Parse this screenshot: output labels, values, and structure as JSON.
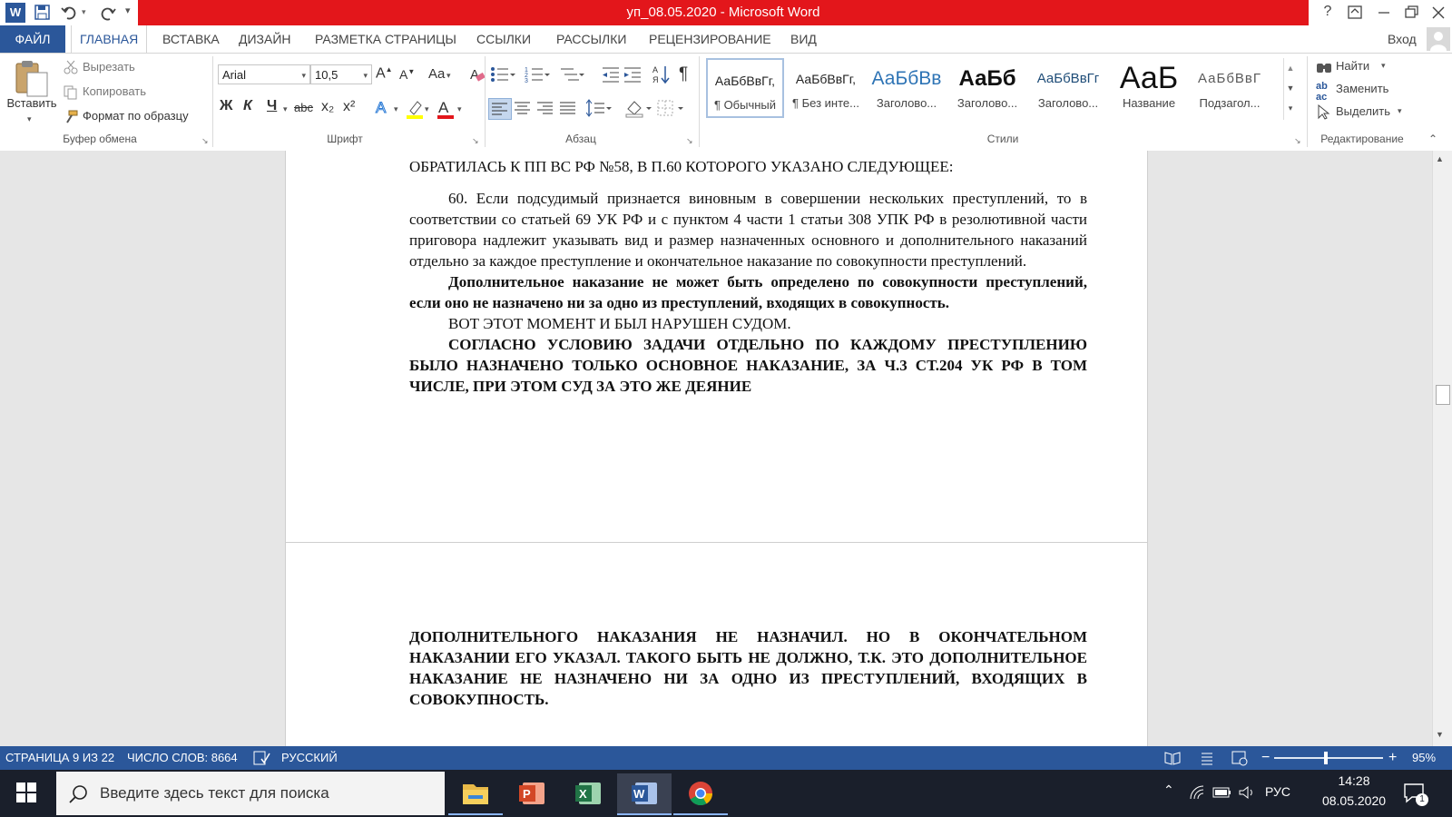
{
  "window": {
    "title": "уп_08.05.2020 -  Microsoft Word",
    "help": "?",
    "sign_in": "Вход"
  },
  "tabs": [
    "ФАЙЛ",
    "ГЛАВНАЯ",
    "ВСТАВКА",
    "ДИЗАЙН",
    "РАЗМЕТКА СТРАНИЦЫ",
    "ССЫЛКИ",
    "РАССЫЛКИ",
    "РЕЦЕНЗИРОВАНИЕ",
    "ВИД"
  ],
  "ribbon": {
    "clipboard": {
      "paste": "Вставить",
      "cut": "Вырезать",
      "copy": "Копировать",
      "format_painter": "Формат по образцу",
      "label": "Буфер обмена"
    },
    "font": {
      "name": "Arial",
      "size": "10,5",
      "change_case": "Aa",
      "bold": "Ж",
      "italic": "К",
      "underline": "Ч",
      "strike": "abc",
      "sub": "x₂",
      "sup": "x²",
      "label": "Шрифт"
    },
    "paragraph": {
      "label": "Абзац"
    },
    "styles": {
      "label": "Стили",
      "items": [
        {
          "preview": "АаБбВвГг,",
          "name": "¶ Обычный"
        },
        {
          "preview": "АаБбВвГг,",
          "name": "¶ Без инте..."
        },
        {
          "preview": "АаБбВв",
          "name": "Заголово..."
        },
        {
          "preview": "АаБб",
          "name": "Заголово..."
        },
        {
          "preview": "АаБбВвГг",
          "name": "Заголово..."
        },
        {
          "preview": "АаБ",
          "name": "Название"
        },
        {
          "preview": "АаБбВвГ",
          "name": "Подзагол..."
        }
      ]
    },
    "editing": {
      "label": "Редактирование",
      "find": "Найти",
      "replace": "Заменить",
      "select": "Выделить"
    }
  },
  "document": {
    "page1": {
      "heading_line": "ОБРАТИЛАСЬ К ПП ВС РФ №58, В П.60 КОТОРОГО УКАЗАНО СЛЕДУЮЩЕЕ:",
      "para1": "60. Если подсудимый признается виновным в совершении нескольких преступлений, то в соответствии со статьей 69 УК РФ и с пунктом 4 части 1 статьи 308 УПК РФ в резолютивной части приговора надлежит указывать вид и размер назначенных основного и дополнительного наказаний отдельно за каждое преступление и окончательное наказание по совокупности преступлений.",
      "para2": "Дополнительное наказание не может быть определено по совокупности преступлений, если оно не назначено ни за одно из преступлений, входящих в совокупность.",
      "para3": "ВОТ ЭТОТ МОМЕНТ И БЫЛ НАРУШЕН СУДОМ.",
      "para4": "СОГЛАСНО УСЛОВИЮ ЗАДАЧИ ОТДЕЛЬНО ПО КАЖДОМУ ПРЕСТУПЛЕНИЮ БЫЛО НАЗНАЧЕНО ТОЛЬКО ОСНОВНОЕ НАКАЗАНИЕ, ЗА Ч.3 СТ.204 УК РФ В ТОМ ЧИСЛЕ, ПРИ ЭТОМ СУД ЗА ЭТО ЖЕ ДЕЯНИЕ"
    },
    "page2": {
      "para1": "ДОПОЛНИТЕЛЬНОГО НАКАЗАНИЯ НЕ НАЗНАЧИЛ. НО В ОКОНЧАТЕЛЬНОМ НАКАЗАНИИ ЕГО УКАЗАЛ. ТАКОГО БЫТЬ НЕ ДОЛЖНО, Т.К. ЭТО ДОПОЛНИТЕЛЬНОЕ НАКАЗАНИЕ НЕ НАЗНАЧЕНО НИ ЗА ОДНО ИЗ ПРЕСТУПЛЕНИЙ, ВХОДЯЩИХ В СОВОКУПНОСТЬ."
    }
  },
  "status": {
    "page": "СТРАНИЦА 9 ИЗ 22",
    "words": "ЧИСЛО СЛОВ: 8664",
    "language": "РУССКИЙ",
    "zoom": "95%",
    "zoom_value": 0.95
  },
  "taskbar": {
    "search_placeholder": "Введите здесь текст для поиска",
    "lang": "РУС",
    "time": "14:28",
    "date": "08.05.2020",
    "notif_count": "1"
  },
  "colors": {
    "title_red": "#e3161b",
    "word_blue": "#2b579a",
    "taskbar": "#1a1f2b"
  }
}
